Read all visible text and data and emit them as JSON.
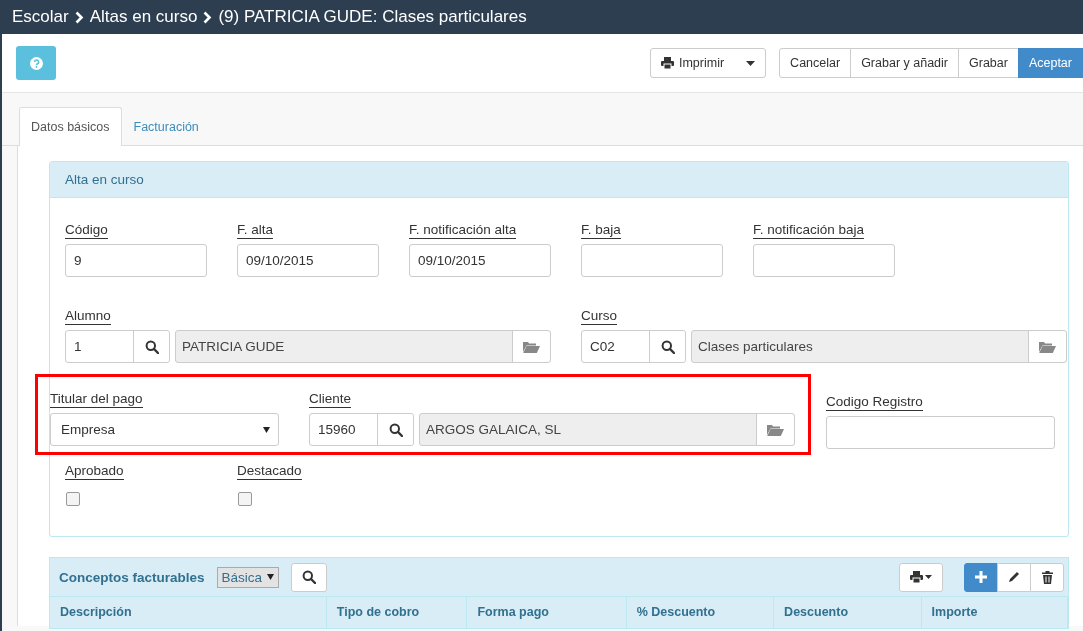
{
  "breadcrumb": [
    "Escolar",
    "Altas en curso",
    "(9) PATRICIA GUDE: Clases particulares"
  ],
  "toolbar": {
    "print_button": "Imprimir",
    "actions": [
      {
        "label": "Cancelar",
        "primary": false
      },
      {
        "label": "Grabar y añadir",
        "primary": false
      },
      {
        "label": "Grabar",
        "primary": false
      },
      {
        "label": "Aceptar",
        "primary": true
      }
    ]
  },
  "tabs": [
    {
      "label": "Datos básicos",
      "selected": true
    },
    {
      "label": "Facturación",
      "selected": false
    }
  ],
  "form_panel": {
    "title": "Alta en curso",
    "rows": [
      {
        "fields": [
          {
            "kind": "text",
            "label": "Código",
            "value": "9"
          },
          {
            "kind": "text",
            "label": "F. alta",
            "value": "09/10/2015"
          },
          {
            "kind": "text",
            "label": "F. notificación alta",
            "value": "09/10/2015"
          },
          {
            "kind": "text",
            "label": "F. baja"
          },
          {
            "kind": "text",
            "label": "F. notificación baja"
          }
        ]
      },
      {
        "fields": [
          {
            "kind": "lookup",
            "label": "Alumno",
            "code": "1",
            "name": "PATRICIA GUDE"
          },
          {
            "kind": "lookup",
            "label": "Curso",
            "code": "C02",
            "name": "Clases particulares"
          }
        ]
      },
      {
        "fields": [
          {
            "kind": "select",
            "label": "Titular del pago",
            "value": "Empresa",
            "highlighted": true
          },
          {
            "kind": "lookup",
            "label": "Cliente",
            "code": "15960",
            "name": "ARGOS GALAICA, SL",
            "highlighted": true
          },
          {
            "kind": "text",
            "label": "Codigo Registro",
            "wide": true
          }
        ]
      },
      {
        "fields": [
          {
            "kind": "checkbox",
            "label": "Aprobado",
            "checked": false
          },
          {
            "kind": "checkbox",
            "label": "Destacado",
            "checked": false
          }
        ]
      }
    ]
  },
  "grid_panel": {
    "title": "Conceptos facturables",
    "view": "Básica",
    "columns": [
      "Descripción",
      "Tipo de cobro",
      "Forma pago",
      "% Descuento",
      "Descuento",
      "Importe"
    ]
  }
}
